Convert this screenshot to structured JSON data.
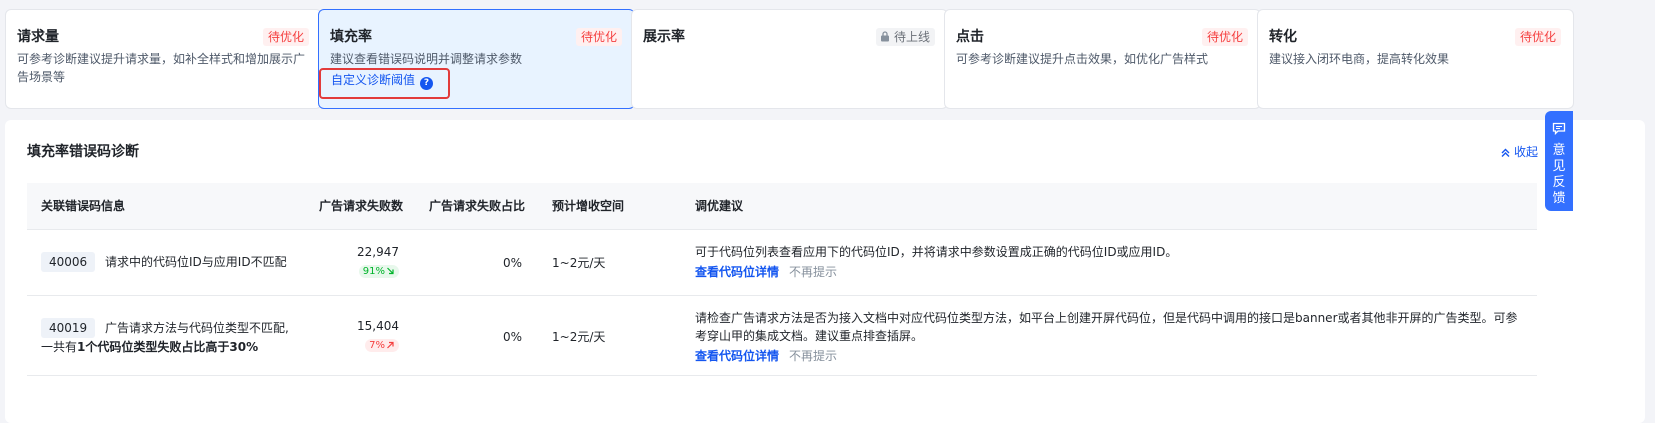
{
  "cards": [
    {
      "title": "请求量",
      "badge": "待优化",
      "desc": "可参考诊断建议提升请求量，如补全样式和增加展示广告场景等"
    },
    {
      "title": "填充率",
      "badge": "待优化",
      "desc": "建议查看错误码说明并调整请求参数",
      "link": "自定义诊断阈值"
    },
    {
      "title": "展示率",
      "badge": "待上线",
      "desc": ""
    },
    {
      "title": "点击",
      "badge": "待优化",
      "desc": "可参考诊断建议提升点击效果，如优化广告样式"
    },
    {
      "title": "转化",
      "badge": "待优化",
      "desc": "建议接入闭环电商，提高转化效果"
    }
  ],
  "panel": {
    "title": "填充率错误码诊断",
    "collapse_label": "收起",
    "columns": [
      "关联错误码信息",
      "广告请求失败数",
      "广告请求失败占比",
      "预计增收空间",
      "调优建议"
    ],
    "rows": [
      {
        "code": "40006",
        "info": "请求中的代码位ID与应用ID不匹配",
        "fail_count": "22,947",
        "trend": "91%",
        "trend_dir": "down",
        "fail_ratio": "0%",
        "revenue": "1~2元/天",
        "advice": "可于代码位列表查看应用下的代码位ID，并将请求中参数设置成正确的代码位ID或应用ID。",
        "link": "查看代码位详情",
        "dismiss": "不再提示"
      },
      {
        "code": "40019",
        "info": "广告请求方法与代码位类型不匹配,",
        "info_line2_prefix": "一共有",
        "info_line2_bold": "1个代码位类型失败占比高于30%",
        "fail_count": "15,404",
        "trend": "7%",
        "trend_dir": "up",
        "fail_ratio": "0%",
        "revenue": "1~2元/天",
        "advice": "请检查广告请求方法是否为接入文档中对应代码位类型方法，如平台上创建开屏代码位，但是代码中调用的接口是banner或者其他非开屏的广告类型。可参考穿山甲的集成文档。建议重点排查插屏。",
        "link": "查看代码位详情",
        "dismiss": "不再提示"
      }
    ]
  },
  "feedback_label": "意见反馈",
  "colors": {
    "accent": "#1456f0",
    "warn": "#f53f3f",
    "success": "#00b42a",
    "highlight": "#e23b3b"
  }
}
